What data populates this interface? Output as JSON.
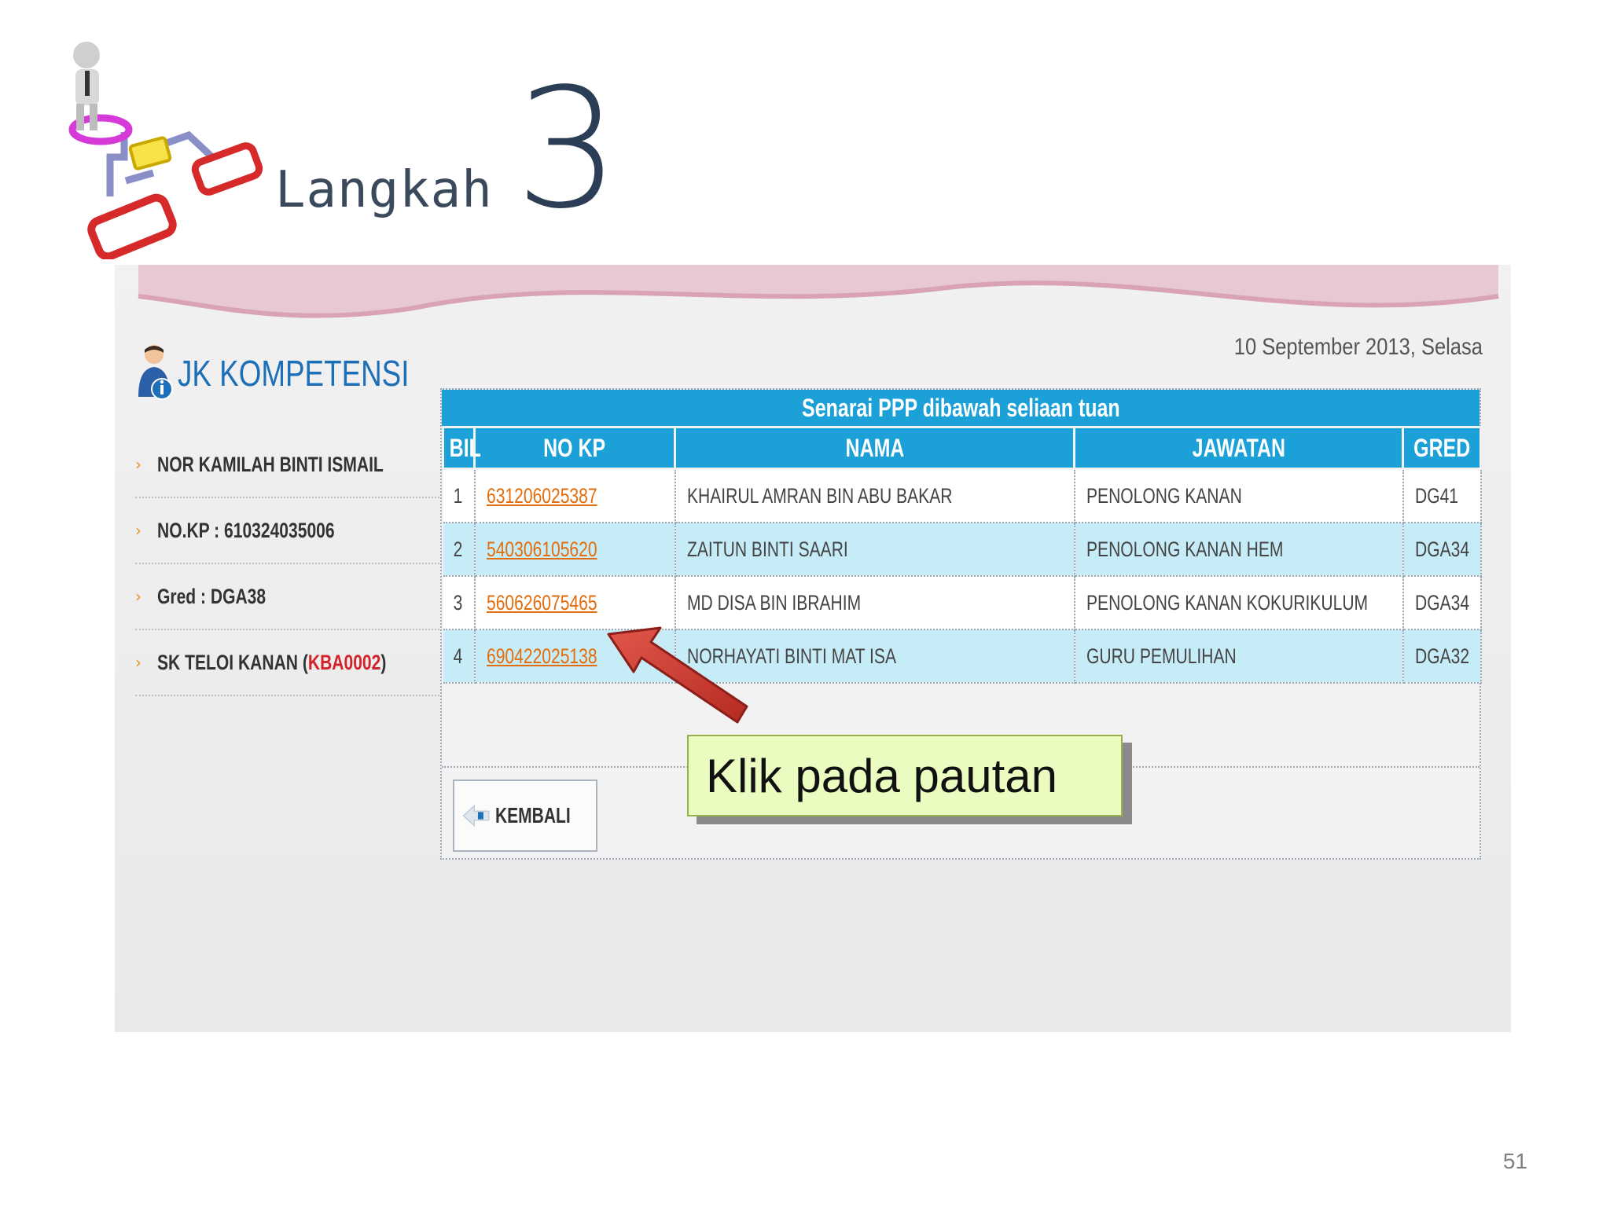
{
  "slide": {
    "step_word": "Langkah",
    "step_number": "3",
    "page_number": "51"
  },
  "app": {
    "date": "10 September 2013, Selasa",
    "brand_title": "JK KOMPETENSI",
    "sidebar": {
      "name": "NOR KAMILAH BINTI ISMAIL",
      "no_kp": "NO.KP : 610324035006",
      "gred": "Gred : DGA38",
      "school_name": "SK TELOI KANAN",
      "school_code": "KBA0002"
    },
    "table": {
      "title": "Senarai PPP dibawah seliaan tuan",
      "headers": [
        "BIL",
        "NO KP",
        "NAMA",
        "JAWATAN",
        "GRED"
      ],
      "rows": [
        {
          "bil": "1",
          "no_kp": "631206025387",
          "nama": "KHAIRUL AMRAN BIN ABU BAKAR",
          "jawatan": "PENOLONG KANAN",
          "gred": "DG41"
        },
        {
          "bil": "2",
          "no_kp": "540306105620",
          "nama": "ZAITUN BINTI SAARI",
          "jawatan": "PENOLONG KANAN HEM",
          "gred": "DGA34"
        },
        {
          "bil": "3",
          "no_kp": "560626075465",
          "nama": "MD DISA BIN IBRAHIM",
          "jawatan": "PENOLONG KANAN KOKURIKULUM",
          "gred": "DGA34"
        },
        {
          "bil": "4",
          "no_kp": "690422025138",
          "nama": "NORHAYATI BINTI MAT ISA",
          "jawatan": "GURU PEMULIHAN",
          "gred": "DGA32"
        }
      ]
    },
    "back_button": "KEMBALI"
  },
  "callout": "Klik pada pautan",
  "colors": {
    "header_blue": "#1ba0d8",
    "row_alt": "#c6ecf8",
    "link_orange": "#e46c0a",
    "code_red": "#d2232a",
    "callout_bg": "#eafcc0",
    "arrow_red": "#c0302a"
  }
}
